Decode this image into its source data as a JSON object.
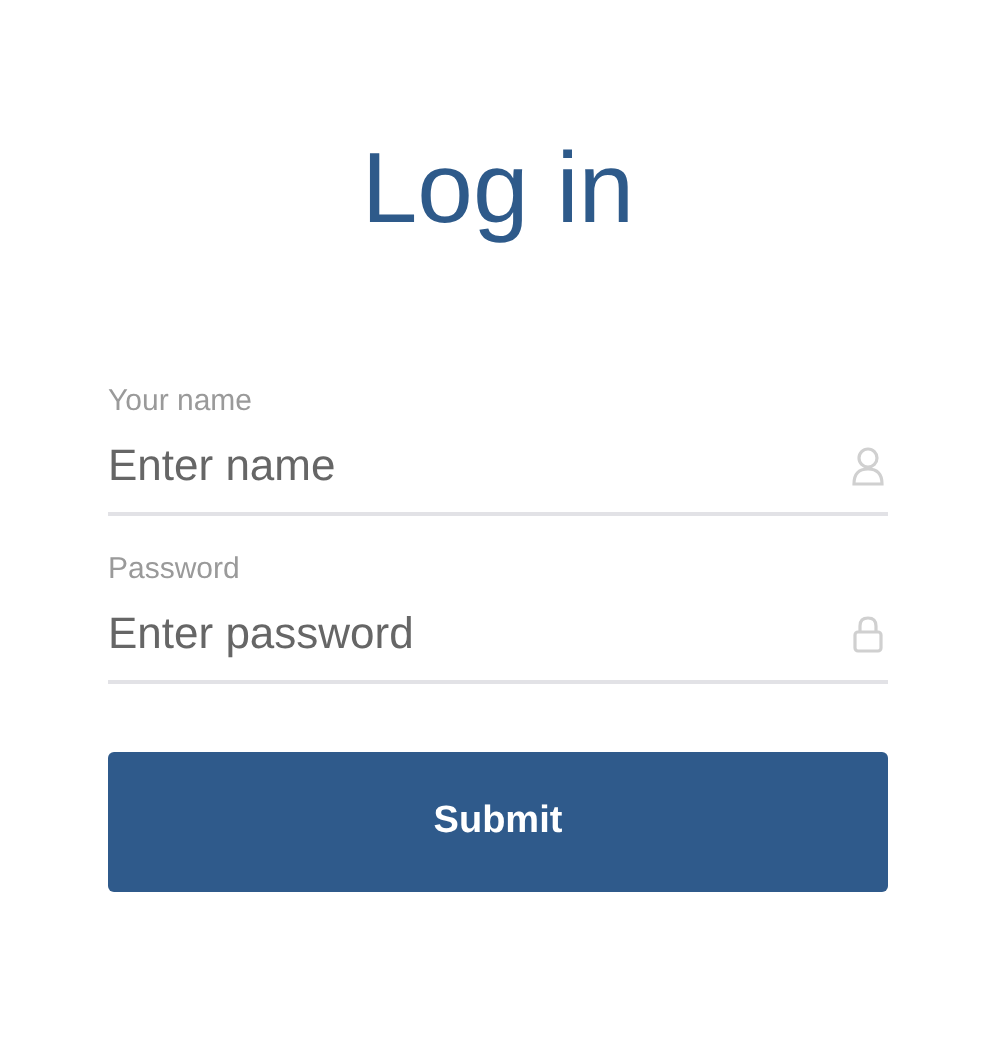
{
  "title": "Log in",
  "fields": [
    {
      "kind": "user",
      "label": "Your name",
      "placeholder": "Enter name"
    },
    {
      "kind": "password",
      "label": "Password",
      "placeholder": "Enter password"
    }
  ],
  "submit": {
    "label": "Submit"
  }
}
